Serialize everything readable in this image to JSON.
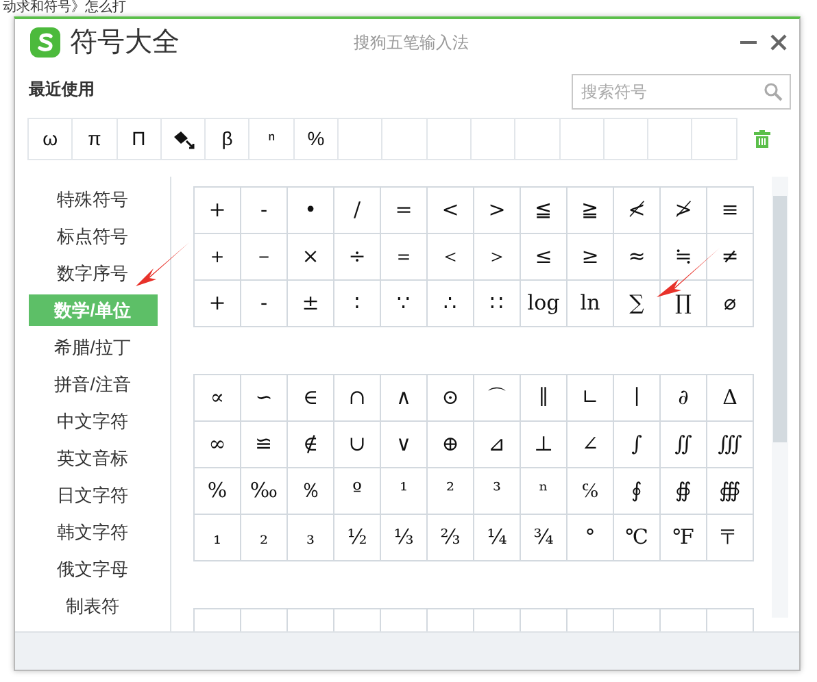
{
  "background_page": {
    "top_line": "动求和符号》怎么打"
  },
  "window": {
    "title": "符号大全",
    "app_name": "搜狗五笔输入法"
  },
  "recent": {
    "label": "最近使用",
    "symbols": [
      {
        "kind": "text",
        "char": "ω"
      },
      {
        "kind": "text",
        "char": "π"
      },
      {
        "kind": "text",
        "char": "Π"
      },
      {
        "kind": "icon"
      },
      {
        "kind": "text",
        "char": "β"
      },
      {
        "kind": "text",
        "char": "ⁿ"
      },
      {
        "kind": "text",
        "char": "%"
      }
    ]
  },
  "search": {
    "placeholder": "搜索符号"
  },
  "categories": [
    {
      "label": "特殊符号",
      "selected": false
    },
    {
      "label": "标点符号",
      "selected": false
    },
    {
      "label": "数字序号",
      "selected": false
    },
    {
      "label": "数学/单位",
      "selected": true
    },
    {
      "label": "希腊/拉丁",
      "selected": false
    },
    {
      "label": "拼音/注音",
      "selected": false
    },
    {
      "label": "中文字符",
      "selected": false
    },
    {
      "label": "英文音标",
      "selected": false
    },
    {
      "label": "日文字符",
      "selected": false
    },
    {
      "label": "韩文字符",
      "selected": false
    },
    {
      "label": "俄文字母",
      "selected": false
    },
    {
      "label": "制表符",
      "selected": false
    }
  ],
  "symbol_groups": [
    {
      "rows": [
        [
          "+",
          "-",
          "•",
          "/",
          "=",
          "<",
          ">",
          "≦",
          "≧",
          "≮",
          "≯",
          "≡"
        ],
        [
          "＋",
          "－",
          "×",
          "÷",
          "＝",
          "＜",
          "＞",
          "≤",
          "≥",
          "≈",
          "≒",
          "≠"
        ],
        [
          "+",
          "-",
          "±",
          "∶",
          "∵",
          "∴",
          "∷",
          "log",
          "ln",
          "∑",
          "∏",
          "⌀"
        ]
      ]
    },
    {
      "rows": [
        [
          "∝",
          "∽",
          "∈",
          "∩",
          "∧",
          "⊙",
          "⌒",
          "∥",
          "∟",
          "∣",
          "∂",
          "Δ"
        ],
        [
          "∞",
          "≌",
          "∉",
          "∪",
          "∨",
          "⊕",
          "⊿",
          "⊥",
          "∠",
          "∫",
          "∬",
          "∭"
        ],
        [
          "%",
          "‰",
          "％",
          "º",
          "¹",
          "²",
          "³",
          "ⁿ",
          "℅",
          "∮",
          "∯",
          "∰"
        ],
        [
          "₁",
          "₂",
          "₃",
          "½",
          "⅓",
          "⅔",
          "¼",
          "¾",
          "°",
          "℃",
          "℉",
          "〒"
        ]
      ]
    },
    {
      "rows": [
        [
          "",
          "",
          "",
          "",
          "",
          "",
          "",
          "",
          "",
          "",
          "",
          ""
        ]
      ]
    }
  ]
}
